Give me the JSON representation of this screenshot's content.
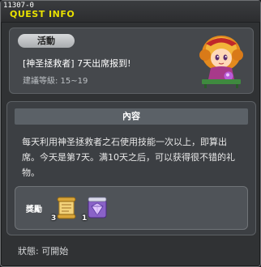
{
  "window": {
    "code": "11307-0",
    "title": "QUEST INFO"
  },
  "quest": {
    "tag": "活動",
    "name": "[神圣拯救者] 7天出席报到!",
    "level_text": "建議等級: 15~19",
    "npc_icon": "girl-npc-portrait"
  },
  "content": {
    "header": "內容",
    "body": "每天利用神圣拯救者之石使用技能一次以上，即算出席。今天是第7天。满10天之后，可以获得很不错的礼物。"
  },
  "reward": {
    "label": "獎勵",
    "items": [
      {
        "icon": "scroll-item-icon",
        "count": "3"
      },
      {
        "icon": "purple-gem-item-icon",
        "count": "1"
      }
    ]
  },
  "status": "狀態: 可開始",
  "colors": {
    "title_yellow": "#e8e000",
    "panel_bg": "#303234",
    "card_bg": "#45484c",
    "header_bg": "#5b6167"
  }
}
